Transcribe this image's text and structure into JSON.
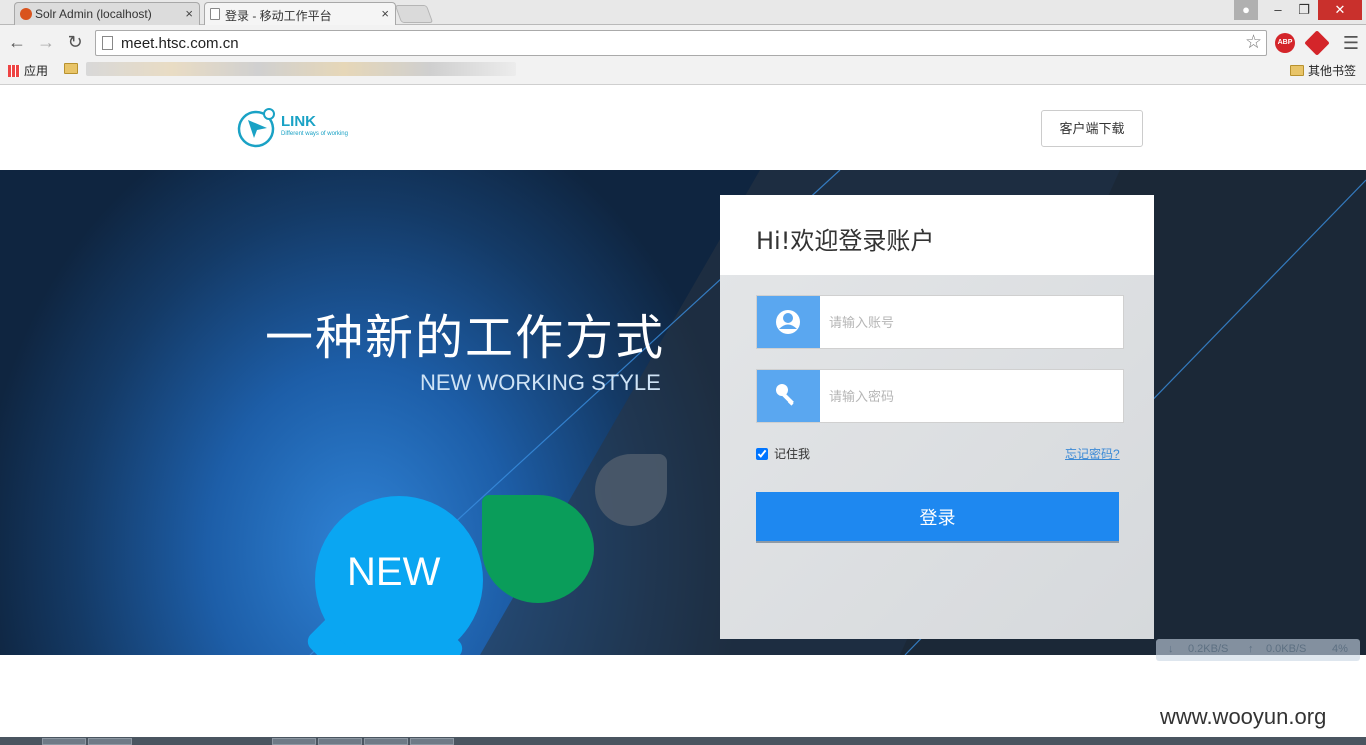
{
  "browser": {
    "tabs": [
      {
        "title": "Solr Admin (localhost)",
        "active": false
      },
      {
        "title": "登录 - 移动工作平台",
        "active": true
      }
    ],
    "url": "meet.htsc.com.cn",
    "bookmarks": {
      "apps_label": "应用",
      "other_label": "其他书签"
    },
    "extensions": [
      "adblock-plus-icon",
      "red-diamond-icon"
    ]
  },
  "header": {
    "logo_text": "LINK",
    "logo_tagline": "Different ways of working",
    "download_label": "客户端下载"
  },
  "hero": {
    "title": "一种新的工作方式",
    "subtitle": "NEW WORKING STYLE",
    "bubble_label": "NEW"
  },
  "login": {
    "title": "Hi!欢迎登录账户",
    "username_placeholder": "请输入账号",
    "password_placeholder": "请输入密码",
    "remember_label": "记住我",
    "remember_checked": true,
    "forgot_label": "忘记密码?",
    "submit_label": "登录"
  },
  "speed_widget": {
    "down": "0.2KB/S",
    "up": "0.0KB/S",
    "cpu": "4%"
  },
  "watermark": "www.wooyun.org",
  "colors": {
    "accent": "#1e88f0",
    "icon_bg": "#5aa7f0",
    "bubble": "#0aa6f2",
    "leaf": "#0a9d5a",
    "logo": "#1aa2c5"
  }
}
